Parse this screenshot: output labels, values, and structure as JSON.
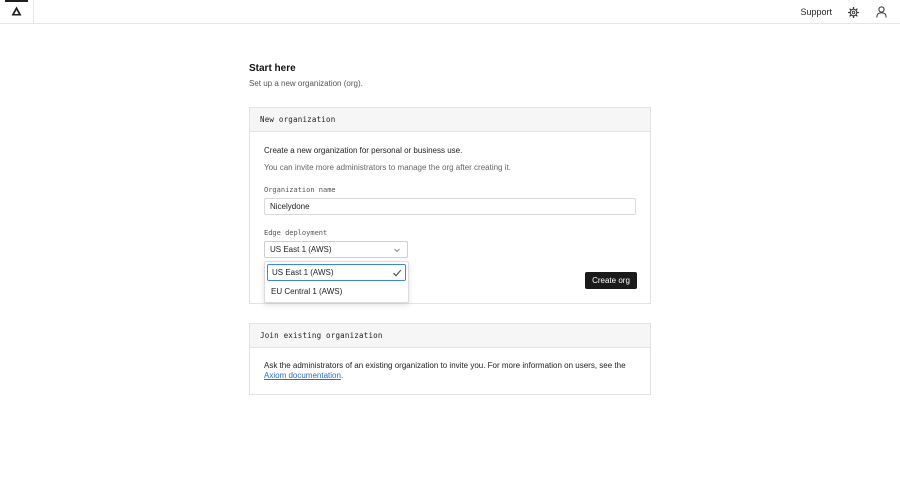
{
  "topbar": {
    "logo_icon": "axiom-logo-icon",
    "support_label": "Support",
    "settings_icon": "gear-icon",
    "user_icon": "user-icon"
  },
  "page": {
    "title": "Start here",
    "subtitle": "Set up a new organization (org)."
  },
  "new_org": {
    "header": "New organization",
    "line1": "Create a new organization for personal or business use.",
    "line2": "You can invite more administrators to manage the org after creating it.",
    "name_label": "Organization name",
    "name_value": "Nicelydone",
    "edge_label": "Edge deployment",
    "edge_selected": "US East 1 (AWS)",
    "edge_options": [
      "US East 1 (AWS)",
      "EU Central 1 (AWS)"
    ],
    "create_label": "Create org"
  },
  "join_org": {
    "header": "Join existing organization",
    "text_before": "Ask the administrators of an existing organization to invite you. For more information on users, see the ",
    "link_text": "Axiom documentation",
    "text_after": "."
  },
  "colors": {
    "accent": "#3b82f6",
    "link": "#2b6cd9",
    "button": "#1a1a1a"
  }
}
